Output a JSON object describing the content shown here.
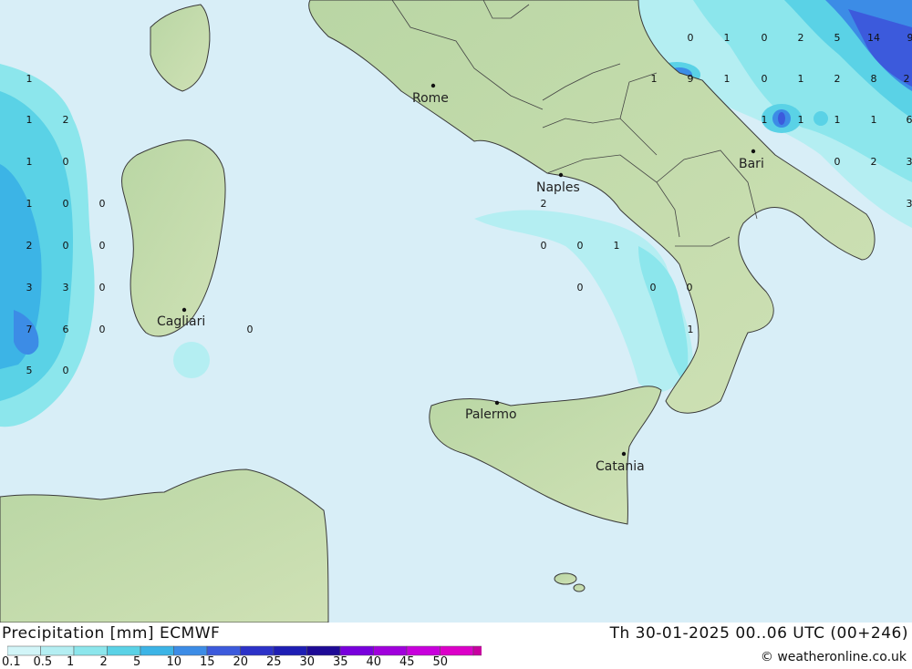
{
  "legend": {
    "title": "Precipitation [mm] ECMWF",
    "datetime": "Th 30-01-2025 00..06 UTC (00+246)",
    "credit": "© weatheronline.co.uk",
    "scale_labels": [
      "0.1",
      "0.5",
      "1",
      "2",
      "5",
      "10",
      "15",
      "20",
      "25",
      "30",
      "35",
      "40",
      "45",
      "50"
    ],
    "scale_colors": [
      "#d2f5f8",
      "#b4eef2",
      "#8ce6ec",
      "#5ad2e6",
      "#3cb4e6",
      "#3c8ce6",
      "#3c5adc",
      "#2c32c8",
      "#1e1eb4",
      "#1e0a96",
      "#7800dc",
      "#a000dc",
      "#c800dc",
      "#dc00c8",
      "#c800a0"
    ]
  },
  "cities": [
    {
      "name": "Rome"
    },
    {
      "name": "Naples"
    },
    {
      "name": "Bari"
    },
    {
      "name": "Cagliari"
    },
    {
      "name": "Palermo"
    },
    {
      "name": "Catania"
    }
  ],
  "values": [
    "0",
    "1",
    "0",
    "2",
    "5",
    "14",
    "9",
    "1",
    "9",
    "1",
    "0",
    "1",
    "2",
    "8",
    "2",
    "1",
    "1",
    "1",
    "1",
    "6",
    "1",
    "1",
    "2",
    "1",
    "0",
    "0",
    "2",
    "3",
    "1",
    "0",
    "0",
    "2",
    "3",
    "2",
    "0",
    "0",
    "0",
    "0",
    "1",
    "3",
    "3",
    "0",
    "0",
    "0",
    "0",
    "7",
    "6",
    "0",
    "0",
    "1",
    "5",
    "0"
  ]
}
